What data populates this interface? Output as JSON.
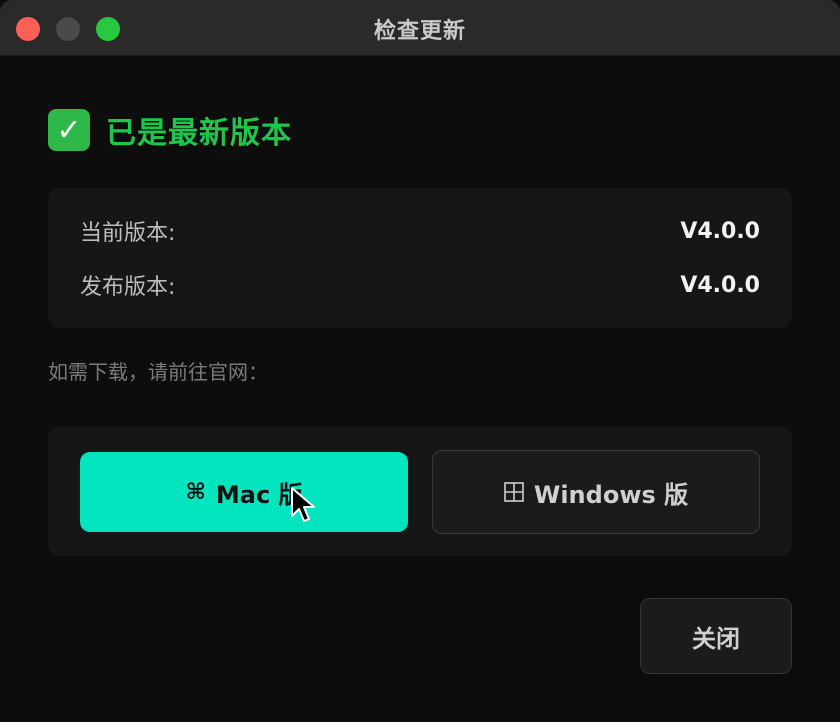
{
  "window": {
    "title": "检查更新"
  },
  "status": {
    "icon": "checkmark-icon",
    "icon_glyph": "✓",
    "text": "已是最新版本",
    "color": "#20c54b"
  },
  "versions": {
    "current_label": "当前版本:",
    "current_value": "V4.0.0",
    "release_label": "发布版本:",
    "release_value": "V4.0.0"
  },
  "download": {
    "hint": "如需下载，请前往官网：",
    "mac_icon_glyph": "⌘",
    "mac_label": "Mac 版",
    "mac_color": "#00e5be",
    "windows_label": "Windows 版"
  },
  "footer": {
    "close_label": "关闭"
  }
}
